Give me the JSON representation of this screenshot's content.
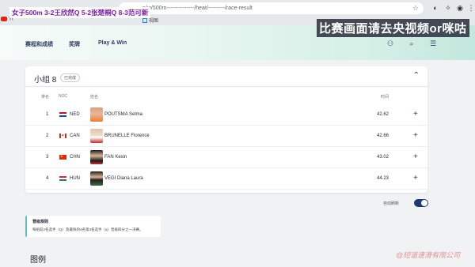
{
  "overlays": {
    "top_left": "女子500m 3-2王欣然Q 5-2张楚桐Q 8-3范可新",
    "top_right": "比赛画面请去央视频or咪咕"
  },
  "browser": {
    "url": "n/w/500m---------------/heat/---------/race-result",
    "bookmarks": [
      "Yt",
      "视图"
    ]
  },
  "nav": {
    "items": [
      "赛程和成绩",
      "奖牌",
      "Play & Win"
    ]
  },
  "card": {
    "title": "小组 8",
    "status": "已完成",
    "headers": {
      "rank": "排名",
      "noc": "NOC",
      "name": "姓名",
      "time": "时间"
    },
    "rows": [
      {
        "rank": "1",
        "noc": "NED",
        "name": "POUTSMA Selma",
        "time": "42.62"
      },
      {
        "rank": "2",
        "noc": "CAN",
        "name": "BRUNELLE Florence",
        "time": "42.66"
      },
      {
        "rank": "3",
        "noc": "CHN",
        "name": "FAN Kexin",
        "time": "43.02"
      },
      {
        "rank": "4",
        "noc": "HUN",
        "name": "VEGI Diana Laura",
        "time": "44.23"
      }
    ]
  },
  "auto_refresh": {
    "label": "自动刷新",
    "on": true
  },
  "rules": {
    "title": "晋级规则",
    "text": "每组前2名选手（Q）及最快的4名第3名选手（q）晋级四分之一决赛。"
  },
  "legend_title": "图例",
  "watermark": "@短道速滑有限公司",
  "colors": {
    "toggle": "#1f3b73",
    "rules_accent": "#5ec2c2",
    "overlay_left": "#7a1fa0"
  }
}
